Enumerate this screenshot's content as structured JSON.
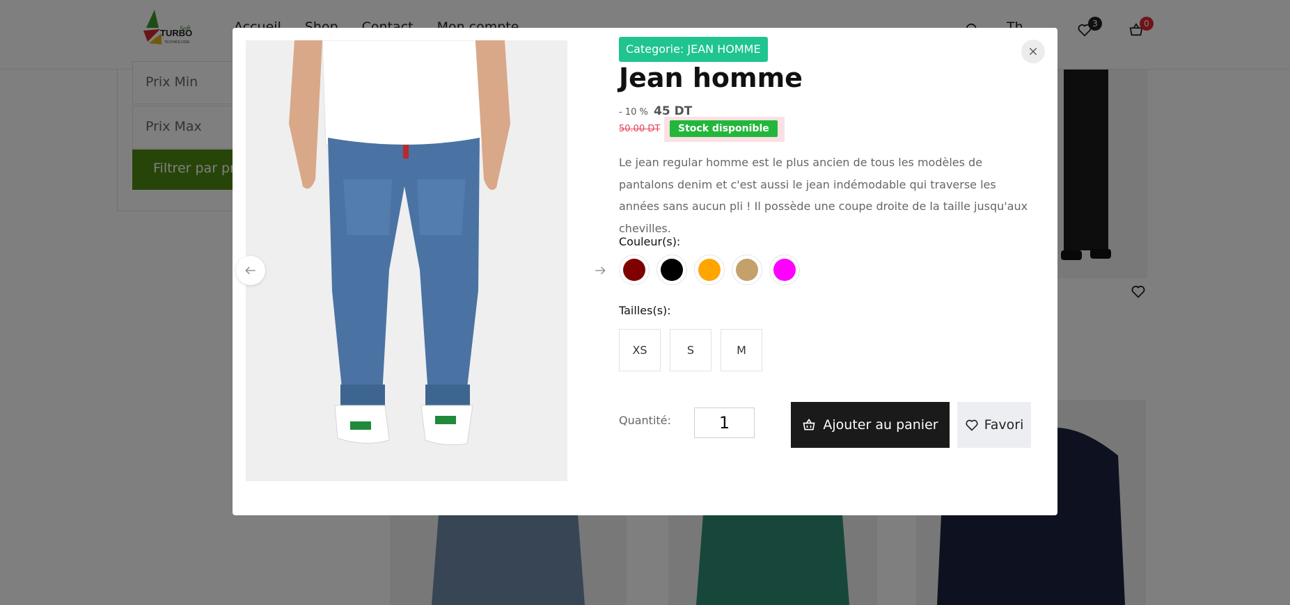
{
  "header": {
    "logo_text": "TURBO Soft TECHNOLOGIE",
    "nav": [
      "Accueil",
      "Shop",
      "Contact",
      "Mon compte"
    ],
    "user_label": "Th",
    "wishlist_count": "3",
    "cart_count": "0"
  },
  "filters": {
    "min_placeholder": "Prix Min",
    "max_placeholder": "Prix Max",
    "button_label": "Filtrer par prix"
  },
  "modal": {
    "category_label": "Categorie: JEAN HOMME",
    "title": "Jean homme",
    "discount": "- 10 %",
    "price": "45 DT",
    "old_price": "50.00 DT",
    "stock_status": "Stock disponible",
    "description": "Le jean regular homme est le plus ancien de tous les modèles de pantalons denim et c'est aussi le jean indémodable qui traverse les années sans aucun pli ! Il possède une coupe droite de la taille jusqu'aux chevilles.",
    "colors_label": "Couleur(s):",
    "colors": [
      "#7f0000",
      "#000000",
      "#ffa500",
      "#c4a06a",
      "#ff00ff"
    ],
    "sizes_label": "Tailles(s):",
    "sizes": [
      "XS",
      "S",
      "M"
    ],
    "quantity_label": "Quantité:",
    "quantity_value": "1",
    "add_to_cart_label": "Ajouter au panier",
    "favorite_label": "Favori",
    "gallery_slide_count": 4,
    "gallery_active_slide": 4
  }
}
